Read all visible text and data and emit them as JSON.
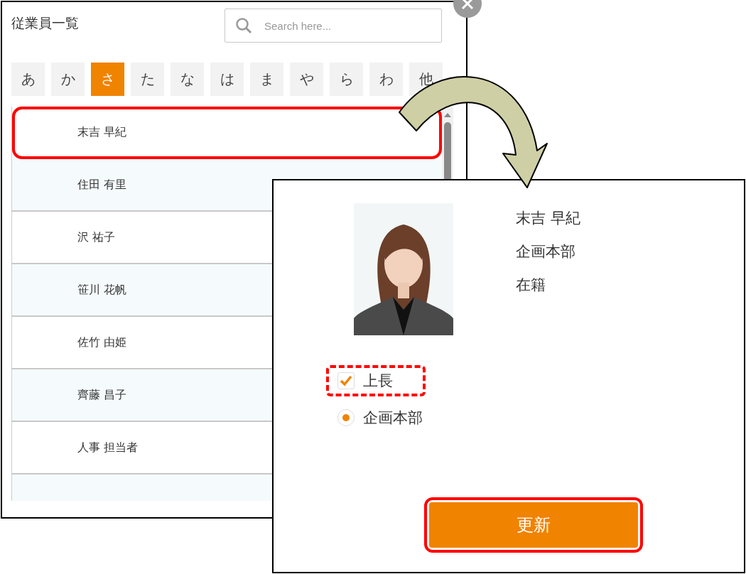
{
  "employee_list": {
    "title": "従業員一覧",
    "search": {
      "placeholder": "Search here..."
    },
    "kana_tabs": [
      {
        "label": "あ",
        "selected": false
      },
      {
        "label": "か",
        "selected": false
      },
      {
        "label": "さ",
        "selected": true
      },
      {
        "label": "た",
        "selected": false
      },
      {
        "label": "な",
        "selected": false
      },
      {
        "label": "は",
        "selected": false
      },
      {
        "label": "ま",
        "selected": false
      },
      {
        "label": "や",
        "selected": false
      },
      {
        "label": "ら",
        "selected": false
      },
      {
        "label": "わ",
        "selected": false
      },
      {
        "label": "他",
        "selected": false
      }
    ],
    "employees": [
      {
        "name": "末吉 早紀",
        "highlighted": true
      },
      {
        "name": "住田 有里",
        "highlighted": false
      },
      {
        "name": "沢 祐子",
        "highlighted": false
      },
      {
        "name": "笹川 花帆",
        "highlighted": false
      },
      {
        "name": "佐竹 由姫",
        "highlighted": false
      },
      {
        "name": "齊藤 昌子",
        "highlighted": false
      },
      {
        "name": "人事 担当者",
        "highlighted": false
      }
    ]
  },
  "employee_detail": {
    "name": "末吉 早紀",
    "department": "企画本部",
    "status": "在籍",
    "supervisor": {
      "label": "上長",
      "checked": true,
      "highlighted": true
    },
    "department_option": {
      "label": "企画本部",
      "selected": true
    },
    "update_button": {
      "label": "更新",
      "highlighted": true
    }
  }
}
